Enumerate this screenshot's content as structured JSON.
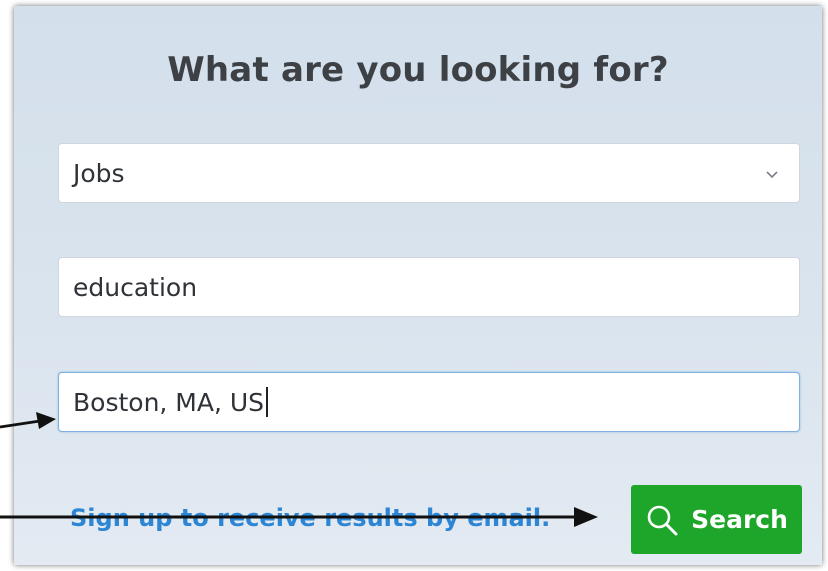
{
  "form": {
    "title": "What are you looking for?",
    "category": {
      "selected": "Jobs",
      "chevron_icon": "chevron-down-icon"
    },
    "keyword": {
      "value": "education"
    },
    "location": {
      "value": "Boston, MA, US"
    },
    "email_link_label": "Sign up to receive results by email.",
    "search_button_label": "Search",
    "search_icon": "search-icon"
  },
  "colors": {
    "accent_green": "#1ea62a",
    "link_blue": "#2d86d4",
    "focus_blue": "#7fb0df",
    "annotation_arrow": "#111111"
  }
}
